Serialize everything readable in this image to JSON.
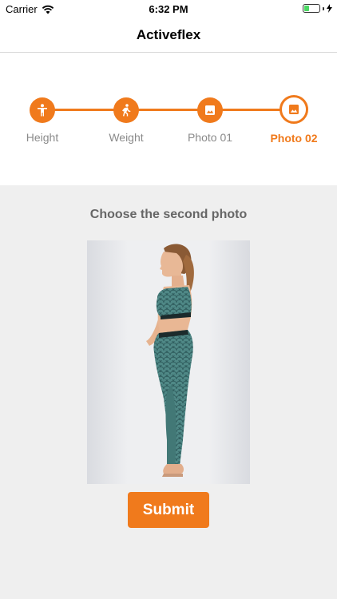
{
  "status_bar": {
    "carrier": "Carrier",
    "time": "6:32 PM",
    "battery_level": 0.35,
    "battery_color": "#4cd964"
  },
  "nav": {
    "title": "Activeflex"
  },
  "stepper": {
    "accent_color": "#f07a1c",
    "inactive_label_color": "#8a8a8a",
    "steps": [
      {
        "label": "Height",
        "icon": "person-icon",
        "state": "done"
      },
      {
        "label": "Weight",
        "icon": "scale-walk-icon",
        "state": "done"
      },
      {
        "label": "Photo 01",
        "icon": "image-icon",
        "state": "done"
      },
      {
        "label": "Photo 02",
        "icon": "image-icon",
        "state": "active"
      }
    ]
  },
  "main": {
    "prompt": "Choose the second photo",
    "photo_icon": "photo-woman-profile",
    "submit_label": "Submit"
  }
}
